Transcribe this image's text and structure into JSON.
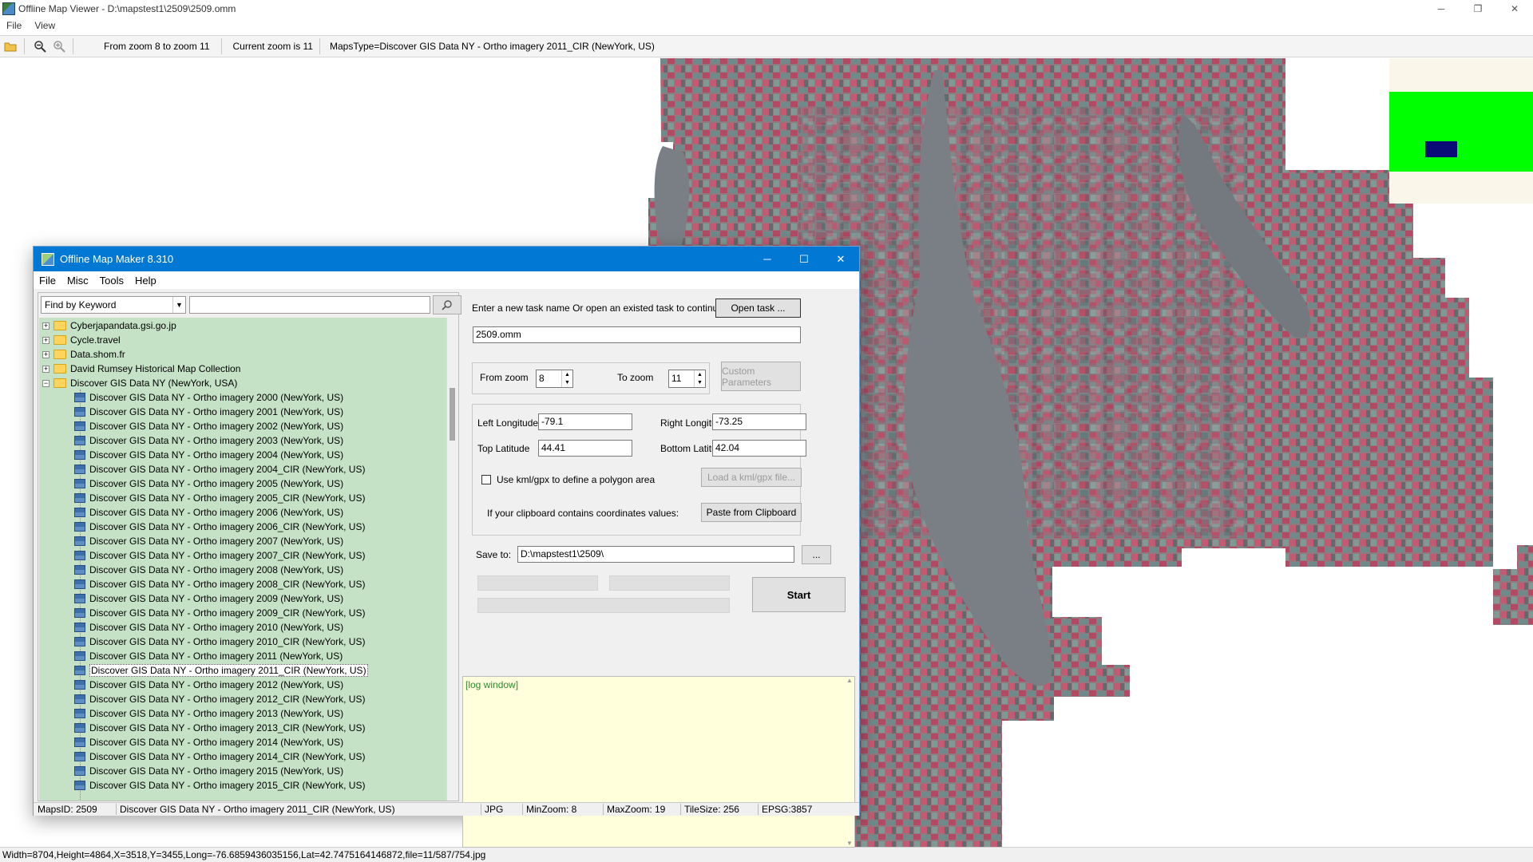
{
  "window": {
    "title": "Offline Map Viewer - D:\\mapstest1\\2509\\2509.omm",
    "minimize": "─",
    "restore": "❐",
    "close": "✕"
  },
  "menu": {
    "file": "File",
    "view": "View"
  },
  "toolbar": {
    "zoom_range": "From zoom 8 to zoom 11",
    "current_zoom": "Current zoom is 11",
    "maps_type": "MapsType=Discover GIS Data NY - Ortho imagery 2011_CIR (NewYork, US)"
  },
  "status_bar": {
    "text": "Width=8704,Height=4864,X=3518,Y=3455,Long=-76.6859436035156,Lat=42.7475164146872,file=11/587/754.jpg"
  },
  "dialog": {
    "title": "Offline Map Maker 8.310",
    "minimize": "─",
    "maximize": "☐",
    "close": "✕",
    "menu": {
      "file": "File",
      "misc": "Misc",
      "tools": "Tools",
      "help": "Help"
    },
    "search": {
      "mode": "Find by Keyword",
      "value": ""
    },
    "tree": {
      "folders": [
        {
          "label": "Cyberjapandata.gsi.go.jp",
          "exp": "+"
        },
        {
          "label": "Cycle.travel",
          "exp": "+"
        },
        {
          "label": "Data.shom.fr",
          "exp": "+"
        },
        {
          "label": "David Rumsey Historical Map Collection",
          "exp": "+"
        },
        {
          "label": "Discover GIS Data NY (NewYork, USA)",
          "exp": "−"
        }
      ],
      "children": [
        "Discover GIS Data NY - Ortho imagery 2000 (NewYork, US)",
        "Discover GIS Data NY - Ortho imagery 2001 (NewYork, US)",
        "Discover GIS Data NY - Ortho imagery 2002 (NewYork, US)",
        "Discover GIS Data NY - Ortho imagery 2003 (NewYork, US)",
        "Discover GIS Data NY - Ortho imagery 2004 (NewYork, US)",
        "Discover GIS Data NY - Ortho imagery 2004_CIR (NewYork, US)",
        "Discover GIS Data NY - Ortho imagery 2005 (NewYork, US)",
        "Discover GIS Data NY - Ortho imagery 2005_CIR (NewYork, US)",
        "Discover GIS Data NY - Ortho imagery 2006 (NewYork, US)",
        "Discover GIS Data NY - Ortho imagery 2006_CIR (NewYork, US)",
        "Discover GIS Data NY - Ortho imagery 2007 (NewYork, US)",
        "Discover GIS Data NY - Ortho imagery 2007_CIR (NewYork, US)",
        "Discover GIS Data NY - Ortho imagery 2008 (NewYork, US)",
        "Discover GIS Data NY - Ortho imagery 2008_CIR (NewYork, US)",
        "Discover GIS Data NY - Ortho imagery 2009 (NewYork, US)",
        "Discover GIS Data NY - Ortho imagery 2009_CIR (NewYork, US)",
        "Discover GIS Data NY - Ortho imagery 2010 (NewYork, US)",
        "Discover GIS Data NY - Ortho imagery 2010_CIR (NewYork, US)",
        "Discover GIS Data NY - Ortho imagery 2011 (NewYork, US)",
        "Discover GIS Data NY - Ortho imagery 2011_CIR (NewYork, US)",
        "Discover GIS Data NY - Ortho imagery 2012 (NewYork, US)",
        "Discover GIS Data NY - Ortho imagery 2012_CIR (NewYork, US)",
        "Discover GIS Data NY - Ortho imagery 2013 (NewYork, US)",
        "Discover GIS Data NY - Ortho imagery 2013_CIR (NewYork, US)",
        "Discover GIS Data NY - Ortho imagery 2014 (NewYork, US)",
        "Discover GIS Data NY - Ortho imagery 2014_CIR (NewYork, US)",
        "Discover GIS Data NY - Ortho imagery 2015 (NewYork, US)",
        "Discover GIS Data NY - Ortho imagery 2015_CIR (NewYork, US)"
      ],
      "selected": "Discover GIS Data NY - Ortho imagery 2011_CIR (NewYork, US)"
    },
    "task": {
      "prompt": "Enter a new task name Or open an existed task to continue:",
      "open_label": "Open task ...",
      "name": "2509.omm"
    },
    "zoom": {
      "from_label": "From zoom",
      "from_value": "8",
      "to_label": "To zoom",
      "to_value": "11",
      "custom_label": "Custom Parameters"
    },
    "coords": {
      "left_lon_label": "Left Longitude",
      "left_lon": "-79.1",
      "right_lon_label": "Right Longitude",
      "right_lon": "-73.25",
      "top_lat_label": "Top Latitude",
      "top_lat": "44.41",
      "bottom_lat_label": "Bottom Latitude",
      "bottom_lat": "42.04",
      "kml_label": "Use kml/gpx to define a polygon area",
      "kml_checked": false,
      "load_kml_label": "Load a kml/gpx file...",
      "clipboard_label": "If your clipboard contains coordinates values:",
      "paste_label": "Paste from Clipboard"
    },
    "save": {
      "label": "Save to:",
      "path": "D:\\mapstest1\\2509\\",
      "browse": "...",
      "start_label": "Start"
    },
    "log": {
      "text": "[log window]"
    },
    "status": {
      "maps_id": "MapsID: 2509",
      "map_name": "Discover GIS Data NY - Ortho imagery 2011_CIR (NewYork, US)",
      "format": "JPG",
      "min_zoom": "MinZoom: 8",
      "max_zoom": "MaxZoom: 19",
      "tile_size": "TileSize: 256",
      "epsg": "EPSG:3857"
    }
  },
  "colors": {
    "accent": "#0078d4",
    "tree_bg": "#c6e2c6",
    "log_bg": "#ffffdc",
    "map_green": "#00ff00",
    "map_navy": "#0b0b78"
  }
}
